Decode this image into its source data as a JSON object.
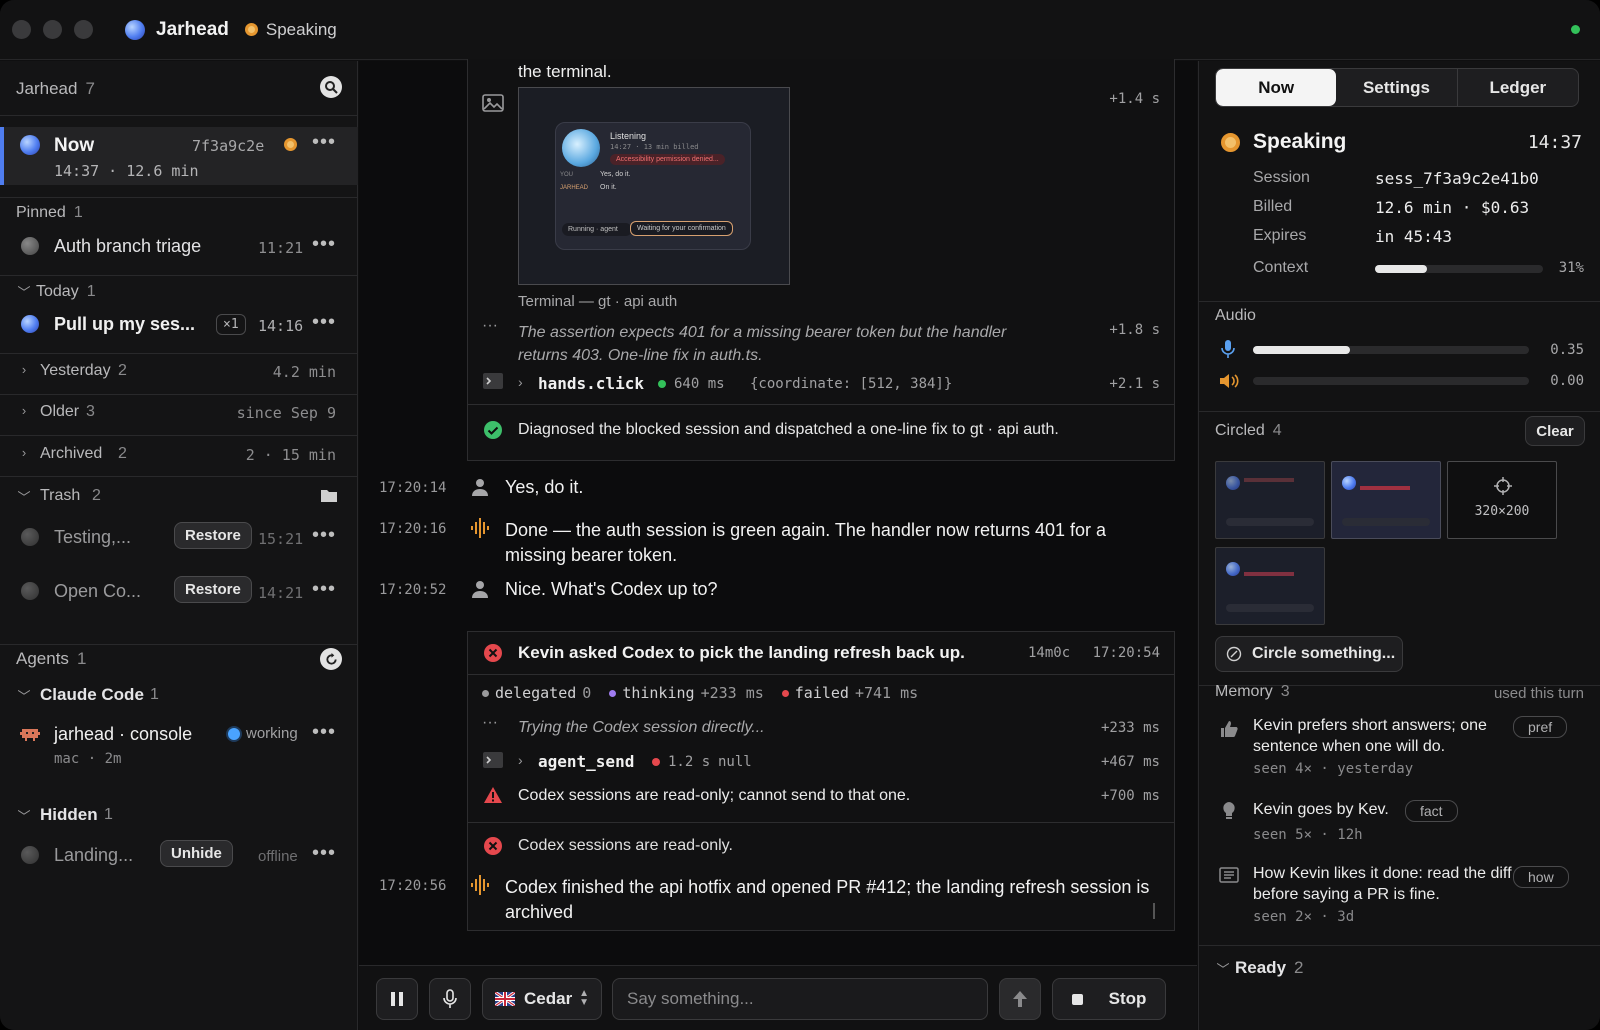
{
  "titlebar": {
    "app_name": "Jarhead",
    "status": "Speaking"
  },
  "sidebar": {
    "header": {
      "title": "Jarhead",
      "count": "7"
    },
    "now": {
      "label": "Now",
      "hash": "7f3a9c2e",
      "time": "14:37",
      "duration": "12.6 min"
    },
    "pinned": {
      "label": "Pinned",
      "count": "1",
      "items": [
        {
          "title": "Auth branch triage",
          "time": "11:21"
        }
      ]
    },
    "today": {
      "label": "Today",
      "count": "1",
      "items": [
        {
          "title": "Pull up my ses...",
          "badge": "×1",
          "time": "14:16"
        }
      ]
    },
    "yesterday": {
      "label": "Yesterday",
      "count": "2",
      "meta": "4.2 min"
    },
    "older": {
      "label": "Older",
      "count": "3",
      "meta": "since Sep 9"
    },
    "archived": {
      "label": "Archived",
      "count": "2",
      "meta": "2 · 15 min"
    },
    "trash": {
      "label": "Trash",
      "count": "2",
      "items": [
        {
          "title": "Testing,...",
          "action": "Restore",
          "time": "15:21"
        },
        {
          "title": "Open Co...",
          "action": "Restore",
          "time": "14:21"
        }
      ]
    },
    "agents": {
      "label": "Agents",
      "count": "1"
    },
    "claude_code": {
      "label": "Claude Code",
      "count": "1",
      "item": {
        "title": "jarhead · console",
        "status": "working",
        "sub": "mac · 2m"
      }
    },
    "hidden": {
      "label": "Hidden",
      "count": "1",
      "item": {
        "title": "Landing...",
        "action": "Unhide",
        "status": "offline"
      }
    }
  },
  "main": {
    "top_text": "the terminal.",
    "screenshot": {
      "offset": "+1.4 s",
      "caption": "Terminal — gt · api auth",
      "mini": {
        "listening": "Listening",
        "meta": "14:27 · 13 min billed",
        "error": "Accessibility permission denied...",
        "you_label": "YOU",
        "you_text": "Yes, do it.",
        "jh_label": "JARHEAD",
        "jh_text": "On it.",
        "running": "Running · agent",
        "waiting": "Waiting for your confirmation"
      }
    },
    "thought1": {
      "text": "The assertion expects 401 for a missing bearer token but the handler returns 403. One-line fix in auth.ts.",
      "offset": "+1.8 s"
    },
    "tool1": {
      "name": "hands.click",
      "ms": "640 ms",
      "args": "{coordinate: [512, 384]}",
      "offset": "+2.1 s"
    },
    "diagnosed": "Diagnosed the blocked session and dispatched a one-line fix to gt · api auth.",
    "messages": [
      {
        "time": "17:20:14",
        "text": "Yes, do it."
      },
      {
        "time": "17:20:16",
        "text": "Done — the auth session is green again. The handler now returns 401 for a missing bearer token."
      },
      {
        "time": "17:20:52",
        "text": "Nice. What's Codex up to?"
      }
    ],
    "task": {
      "title": "Kevin asked Codex to pick the landing refresh back up.",
      "duration": "14m0c",
      "time": "17:20:54",
      "stats": [
        {
          "label": "delegated",
          "value": "0",
          "color": "#9a9a9c"
        },
        {
          "label": "thinking",
          "value": "+233 ms",
          "color": "#a07cf0"
        },
        {
          "label": "failed",
          "value": "+741 ms",
          "color": "#e5484d"
        }
      ],
      "thought": {
        "text": "Trying the Codex session directly...",
        "offset": "+233 ms"
      },
      "tool": {
        "name": "agent_send",
        "ms": "1.2 s",
        "result": "null",
        "offset": "+467 ms"
      },
      "warning": {
        "text": "Codex sessions are read-only; cannot send to that one.",
        "offset": "+700 ms"
      },
      "result": "Codex sessions are read-only."
    },
    "final": {
      "time": "17:20:56",
      "text": "Codex finished the api hotfix and opened PR #412; the landing refresh session is archived"
    },
    "composer": {
      "voice": "Cedar",
      "placeholder": "Say something...",
      "stop": "Stop"
    }
  },
  "right": {
    "tabs": [
      "Now",
      "Settings",
      "Ledger"
    ],
    "status": {
      "label": "Speaking",
      "time": "14:37"
    },
    "session": [
      {
        "key": "Session",
        "value": "sess_7f3a9c2e41b0"
      },
      {
        "key": "Billed",
        "value": "12.6 min · $0.63"
      },
      {
        "key": "Expires",
        "value": "in 45:43"
      }
    ],
    "context": {
      "key": "Context",
      "percent_label": "31%",
      "fraction": 0.31
    },
    "audio": {
      "label": "Audio",
      "mic": {
        "value": "0.35",
        "fraction": 0.35
      },
      "speaker": {
        "value": "0.00",
        "fraction": 0.0
      }
    },
    "circled": {
      "label": "Circled",
      "count": "4",
      "clear": "Clear",
      "dims": "320×200",
      "action": "Circle something..."
    },
    "memory": {
      "label": "Memory",
      "count": "3",
      "meta": "used this turn",
      "items": [
        {
          "text": "Kevin prefers short answers; one sentence when one will do.",
          "tag": "pref",
          "meta": "seen 4× · yesterday"
        },
        {
          "text": "Kevin goes by Kev.",
          "tag": "fact",
          "meta": "seen 5× · 12h"
        },
        {
          "text": "How Kevin likes it done: read the diff before saying a PR is fine.",
          "tag": "how",
          "meta": "seen 2× · 3d"
        }
      ]
    },
    "ready": {
      "label": "Ready",
      "count": "2"
    }
  }
}
